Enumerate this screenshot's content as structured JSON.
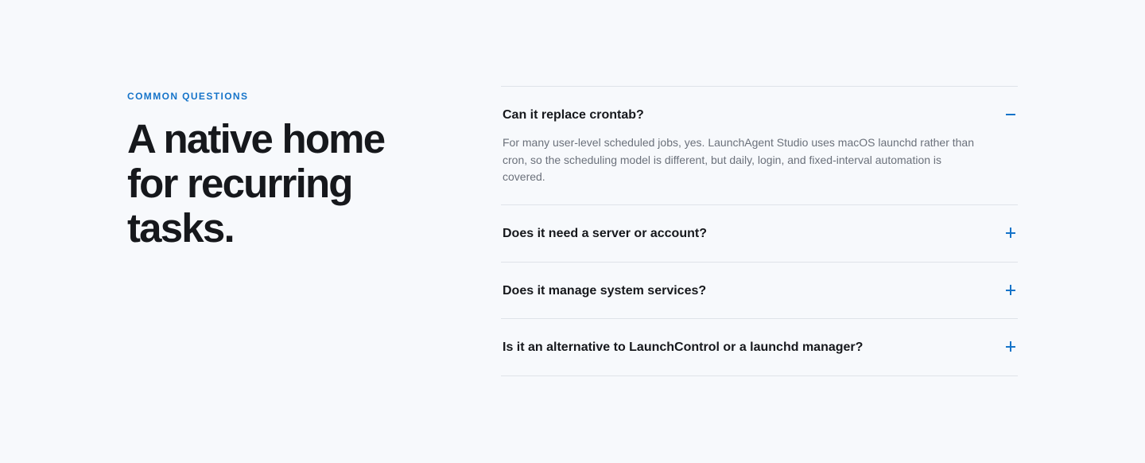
{
  "intro": {
    "eyebrow": "COMMON QUESTIONS",
    "headline": "A native home for recurring tasks."
  },
  "accent_color": "#1674c9",
  "faq": {
    "items": [
      {
        "question": "Can it replace crontab?",
        "answer": "For many user-level scheduled jobs, yes. LaunchAgent Studio uses macOS launchd rather than cron, so the scheduling model is different, but daily, login, and fixed-interval automation is covered.",
        "expanded": true,
        "toggle_icon": "minus-icon"
      },
      {
        "question": "Does it need a server or account?",
        "expanded": false,
        "toggle_icon": "plus-icon"
      },
      {
        "question": "Does it manage system services?",
        "expanded": false,
        "toggle_icon": "plus-icon"
      },
      {
        "question": "Is it an alternative to LaunchControl or a launchd manager?",
        "expanded": false,
        "toggle_icon": "plus-icon"
      }
    ]
  }
}
